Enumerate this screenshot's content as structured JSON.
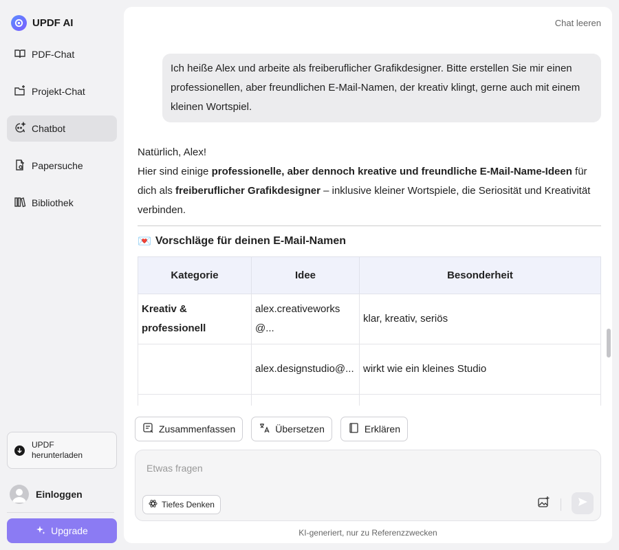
{
  "brand": {
    "name": "UPDF AI",
    "accent": "#8b7bf3"
  },
  "sidebar": {
    "items": [
      {
        "label": "PDF-Chat",
        "icon": "book-open-icon",
        "active": false
      },
      {
        "label": "Projekt-Chat",
        "icon": "folder-plus-icon",
        "active": false
      },
      {
        "label": "Chatbot",
        "icon": "chatbot-icon",
        "active": true
      },
      {
        "label": "Papersuche",
        "icon": "document-search-icon",
        "active": false
      },
      {
        "label": "Bibliothek",
        "icon": "library-icon",
        "active": false
      }
    ],
    "download_line1": "UPDF",
    "download_line2": "herunterladen",
    "login": "Einloggen",
    "upgrade": "Upgrade"
  },
  "header": {
    "clear_chat": "Chat leeren"
  },
  "chat": {
    "user_message": "Ich heiße Alex und arbeite als freiberuflicher Grafikdesigner. Bitte erstellen Sie mir einen professionellen, aber freundlichen E-Mail-Namen, der kreativ klingt, gerne auch mit einem kleinen Wortspiel.",
    "answer": {
      "greeting": "Natürlich, Alex!",
      "p1": "Hier sind einige ",
      "b1": "professionelle, aber dennoch kreative und freundliche E-Mail-Name-Ideen",
      "p2": " für dich als ",
      "b2": "freiberuflicher Grafikdesigner",
      "p3": " – inklusive kleiner Wortspiele, die Seriosität und Kreativität verbinden."
    },
    "section_emoji": "💌",
    "section_title": "Vorschläge für deinen E-Mail-Namen",
    "table": {
      "headers": [
        "Kategorie",
        "Idee",
        "Besonderheit"
      ],
      "rows": [
        {
          "category": "Kreativ & professionell",
          "idea": "alex.creativeworks@...",
          "feature": "klar, kreativ, seriös"
        },
        {
          "category": "",
          "idea": "alex.designstudio@...",
          "feature": "wirkt wie ein kleines Studio"
        }
      ]
    }
  },
  "actions": [
    {
      "label": "Zusammenfassen",
      "icon": "summary-icon"
    },
    {
      "label": "Übersetzen",
      "icon": "translate-icon"
    },
    {
      "label": "Erklären",
      "icon": "explain-icon"
    }
  ],
  "input": {
    "placeholder": "Etwas fragen",
    "value": "",
    "deep_think": "Tiefes Denken"
  },
  "footer": {
    "note": "KI-generiert, nur zu Referenzzwecken"
  }
}
